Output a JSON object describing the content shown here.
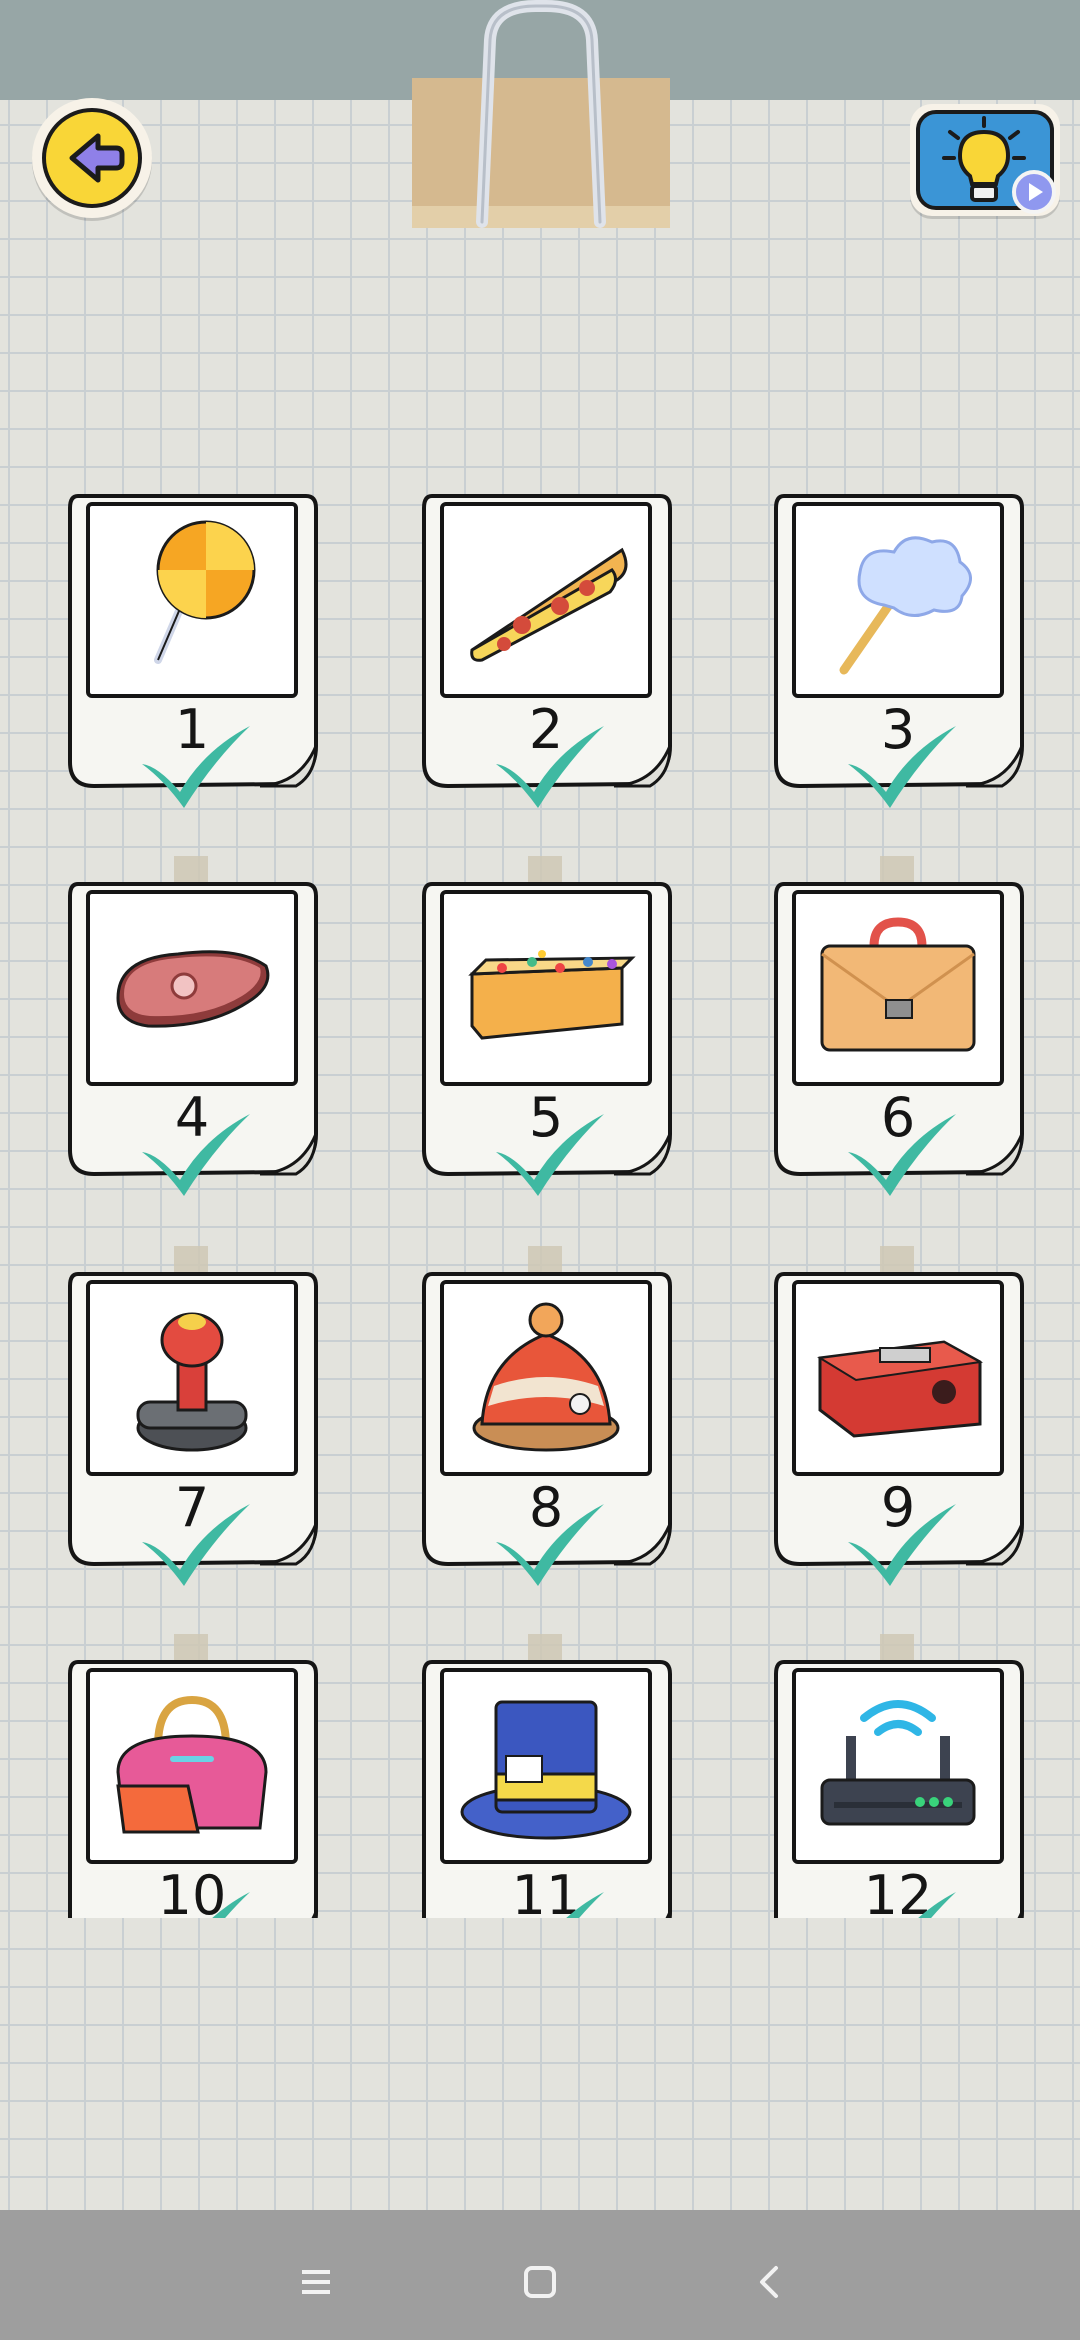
{
  "header": {
    "back_icon": "arrow-left-icon",
    "hint_icon": "lightbulb-icon",
    "hint_video_icon": "play-video-icon"
  },
  "levels": [
    {
      "number": "1",
      "item": "lollipop",
      "completed": true
    },
    {
      "number": "2",
      "item": "pizza-slice",
      "completed": true
    },
    {
      "number": "3",
      "item": "cotton-candy",
      "completed": true
    },
    {
      "number": "4",
      "item": "steak",
      "completed": true
    },
    {
      "number": "5",
      "item": "sprinkle-cake",
      "completed": true
    },
    {
      "number": "6",
      "item": "briefcase",
      "completed": true
    },
    {
      "number": "7",
      "item": "rubber-stamp",
      "completed": true
    },
    {
      "number": "8",
      "item": "knit-hat",
      "completed": true
    },
    {
      "number": "9",
      "item": "pencil-sharpener",
      "completed": true
    },
    {
      "number": "10",
      "item": "handbag",
      "completed": true
    },
    {
      "number": "11",
      "item": "top-hat",
      "completed": true
    },
    {
      "number": "12",
      "item": "wifi-router",
      "completed": true
    }
  ],
  "colors": {
    "check": "#3fb9a2",
    "back_button": "#f9d637",
    "hint_button": "#3b95d6",
    "top_bar": "#97a6a6"
  },
  "navbar": {
    "menu_icon": "menu-icon",
    "home_icon": "home-square-icon",
    "back_icon": "back-chevron-icon"
  }
}
